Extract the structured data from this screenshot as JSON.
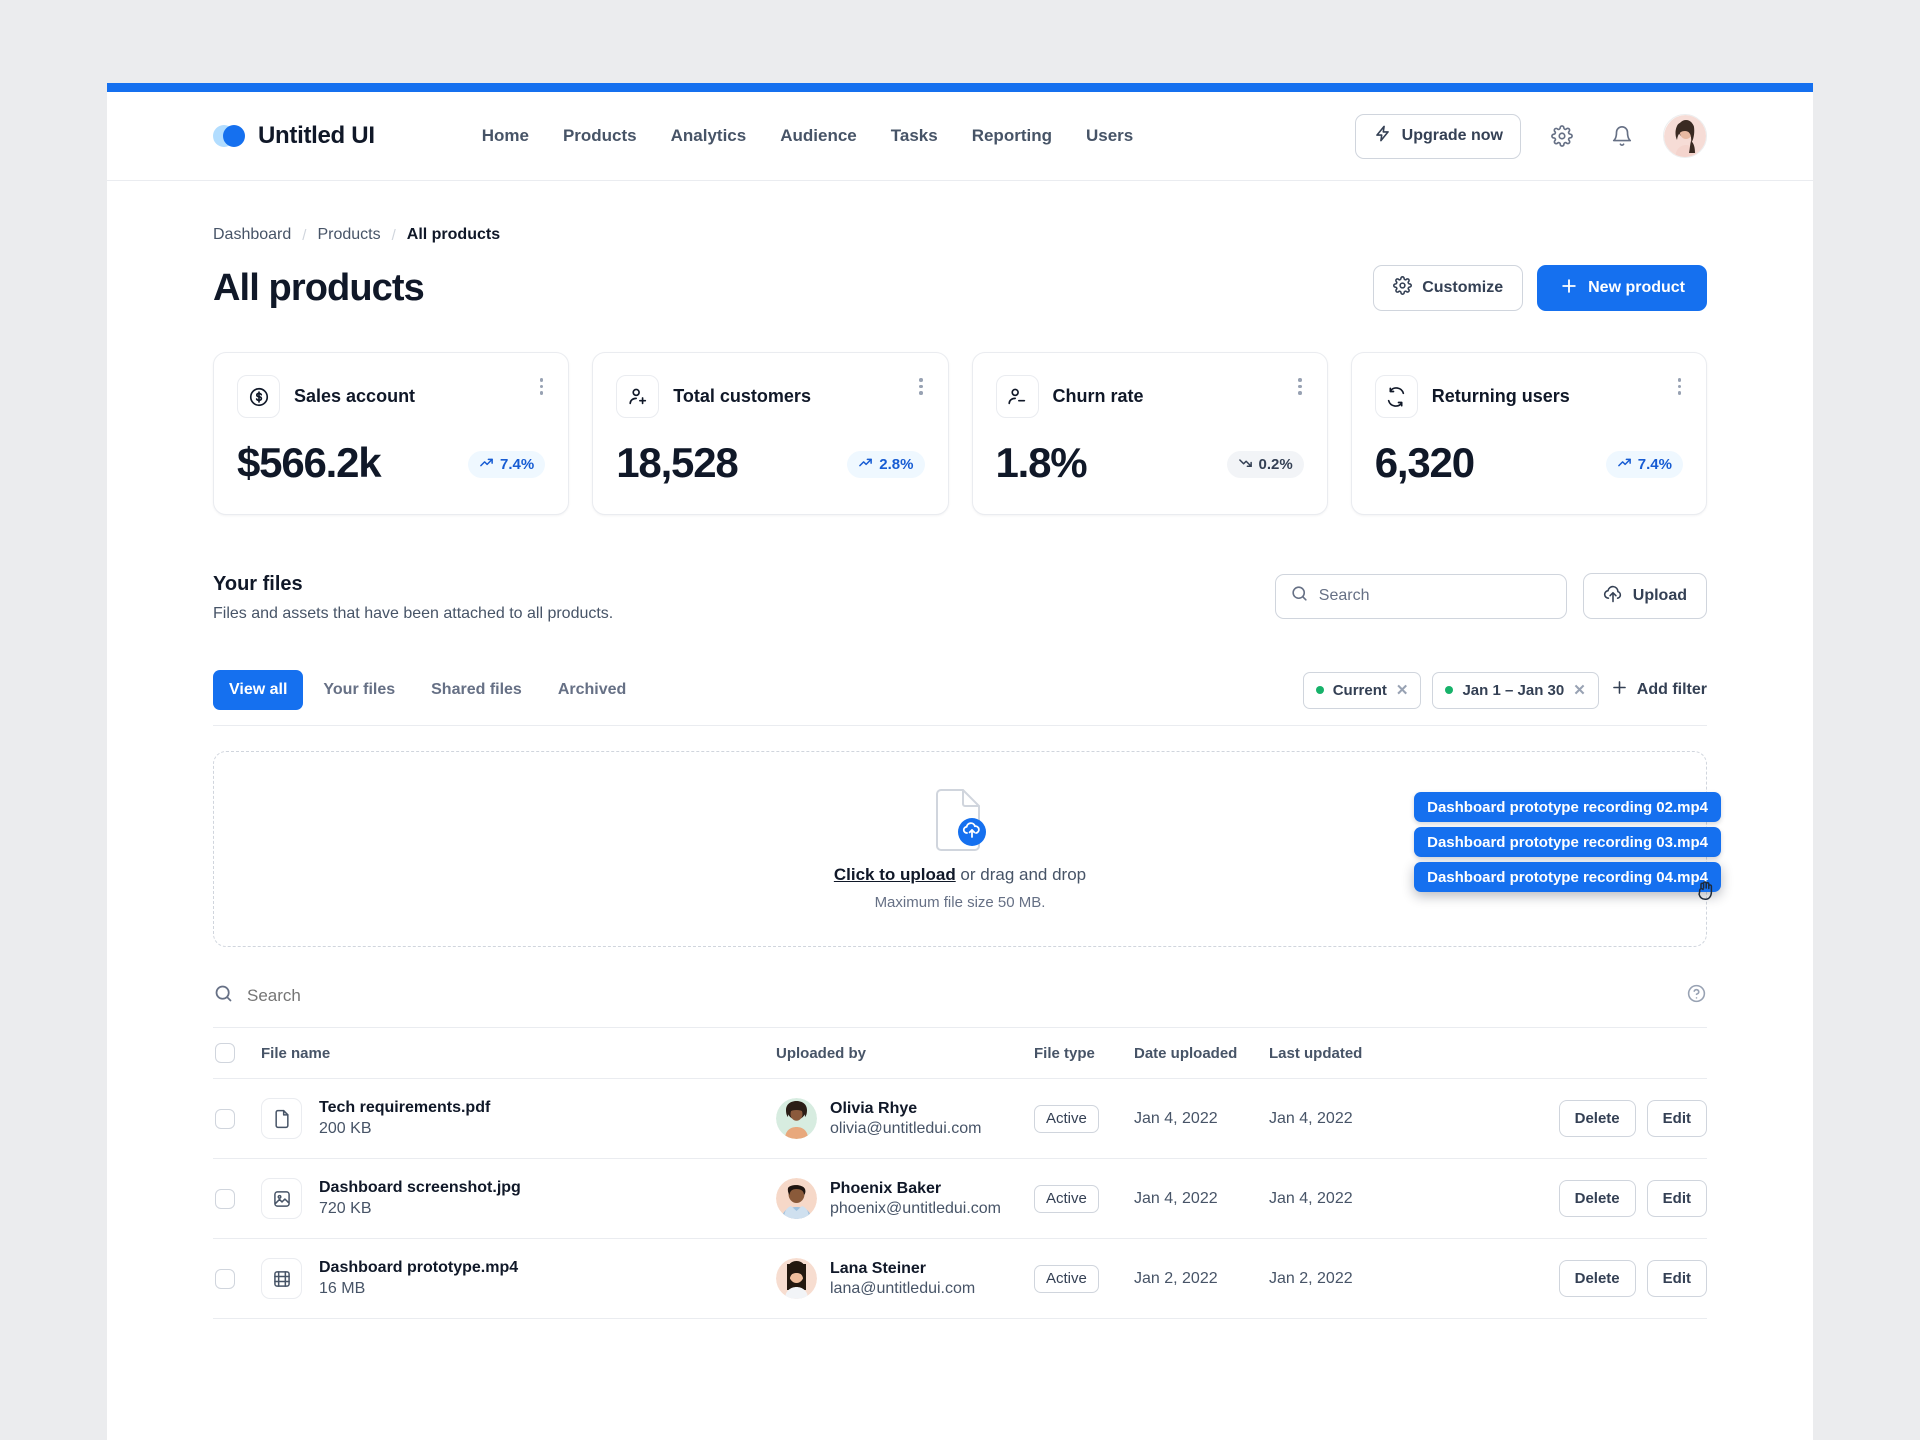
{
  "brand": {
    "name": "Untitled UI",
    "accent": "#1570ef"
  },
  "nav": {
    "items": [
      {
        "label": "Home"
      },
      {
        "label": "Products"
      },
      {
        "label": "Analytics"
      },
      {
        "label": "Audience"
      },
      {
        "label": "Tasks"
      },
      {
        "label": "Reporting"
      },
      {
        "label": "Users"
      }
    ],
    "upgrade_label": "Upgrade now",
    "settings_icon": "gear-icon",
    "notifications_icon": "bell-icon",
    "avatar_icon": "user-avatar"
  },
  "breadcrumb": [
    {
      "label": "Dashboard",
      "current": false
    },
    {
      "label": "Products",
      "current": false
    },
    {
      "label": "All products",
      "current": true
    }
  ],
  "page": {
    "title": "All products",
    "customize_label": "Customize",
    "new_product_label": "New product"
  },
  "metrics": [
    {
      "label": "Sales account",
      "value": "$566.2k",
      "delta": "7.4%",
      "direction": "up",
      "icon": "dollar-circle-icon"
    },
    {
      "label": "Total customers",
      "value": "18,528",
      "delta": "2.8%",
      "direction": "up",
      "icon": "user-plus-icon"
    },
    {
      "label": "Churn rate",
      "value": "1.8%",
      "delta": "0.2%",
      "direction": "down",
      "icon": "user-minus-icon"
    },
    {
      "label": "Returning users",
      "value": "6,320",
      "delta": "7.4%",
      "direction": "up",
      "icon": "refresh-icon"
    }
  ],
  "files": {
    "title": "Your files",
    "subtitle": "Files and assets that have been attached to all products.",
    "search_placeholder": "Search",
    "upload_label": "Upload",
    "tabs": [
      {
        "label": "View all",
        "active": true
      },
      {
        "label": "Your files",
        "active": false
      },
      {
        "label": "Shared files",
        "active": false
      },
      {
        "label": "Archived",
        "active": false
      }
    ],
    "filters": [
      {
        "label": "Current",
        "dot_color": "#17b26a"
      },
      {
        "label": "Jan 1 – Jan 30",
        "dot_color": "#17b26a"
      }
    ],
    "add_filter_label": "Add filter"
  },
  "dropzone": {
    "link_text": "Click to upload",
    "rest_text": " or drag and drop",
    "max_size": "Maximum file size 50 MB.",
    "dragging_files": [
      "Dashboard prototype recording 02.mp4",
      "Dashboard prototype recording 03.mp4",
      "Dashboard prototype recording 04.mp4"
    ]
  },
  "table": {
    "search_placeholder": "Search",
    "columns": [
      "File name",
      "Uploaded by",
      "File type",
      "Date uploaded",
      "Last updated"
    ],
    "rows": [
      {
        "file_name": "Tech requirements.pdf",
        "file_size": "200 KB",
        "file_icon": "pdf-file-icon",
        "user_name": "Olivia Rhye",
        "user_email": "olivia@untitledui.com",
        "file_type": "Active",
        "date_uploaded": "Jan 4, 2022",
        "last_updated": "Jan 4, 2022",
        "delete_label": "Delete",
        "edit_label": "Edit"
      },
      {
        "file_name": "Dashboard screenshot.jpg",
        "file_size": "720 KB",
        "file_icon": "image-file-icon",
        "user_name": "Phoenix Baker",
        "user_email": "phoenix@untitledui.com",
        "file_type": "Active",
        "date_uploaded": "Jan 4, 2022",
        "last_updated": "Jan 4, 2022",
        "delete_label": "Delete",
        "edit_label": "Edit"
      },
      {
        "file_name": "Dashboard prototype.mp4",
        "file_size": "16 MB",
        "file_icon": "video-file-icon",
        "user_name": "Lana Steiner",
        "user_email": "lana@untitledui.com",
        "file_type": "Active",
        "date_uploaded": "Jan 2, 2022",
        "last_updated": "Jan 2, 2022",
        "delete_label": "Delete",
        "edit_label": "Edit"
      }
    ]
  }
}
